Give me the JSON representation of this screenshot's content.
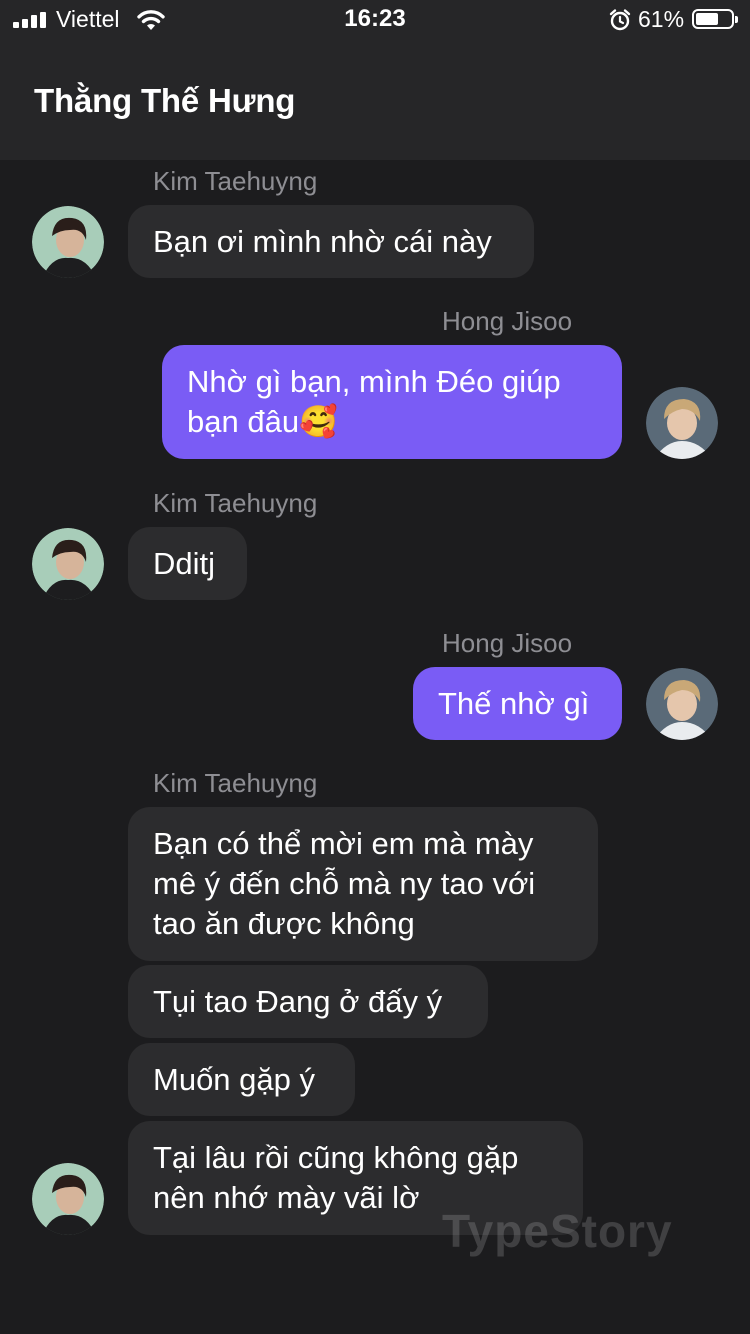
{
  "status_bar": {
    "carrier": "Viettel",
    "time": "16:23",
    "battery_percent": "61%",
    "battery_level": 0.61,
    "icons": [
      "signal-icon",
      "wifi-icon",
      "alarm-icon",
      "battery-icon"
    ]
  },
  "header": {
    "title": "Thằng Thế Hưng"
  },
  "messages": [
    {
      "sender": "Kim Taehuyng",
      "side": "left",
      "text": "Bạn ơi mình nhờ cái này"
    },
    {
      "sender": "Hong Jisoo",
      "side": "right",
      "text": "Nhờ gì bạn, mình Đéo giúp\nbạn đâu🥰"
    },
    {
      "sender": "Kim Taehuyng",
      "side": "left",
      "text": "Dditj"
    },
    {
      "sender": "Hong Jisoo",
      "side": "right",
      "text": "Thế nhờ gì"
    },
    {
      "sender": "Kim Taehuyng",
      "side": "left",
      "text": "Bạn có thể mời em mà mày\nmê ý đến chỗ mà ny tao với\ntao ăn được không"
    },
    {
      "sender": "Kim Taehuyng",
      "side": "left",
      "text": "Tụi tao Đang ở đấy ý"
    },
    {
      "sender": "Kim Taehuyng",
      "side": "left",
      "text": "Muốn gặp ý"
    },
    {
      "sender": "Kim Taehuyng",
      "side": "left",
      "text": "Tại lâu rồi cũng không gặp\nnên nhớ mày vãi lờ"
    }
  ],
  "watermark": "TypeStory",
  "colors": {
    "background": "#1c1c1e",
    "header": "#262628",
    "received_bubble": "#2c2c2e",
    "sent_bubble": "#7a5cf5",
    "sender_name": "#8e8e93"
  }
}
